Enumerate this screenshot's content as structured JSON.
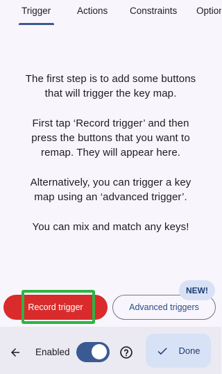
{
  "tabs": [
    {
      "label": "Trigger",
      "selected": true
    },
    {
      "label": "Actions",
      "selected": false
    },
    {
      "label": "Constraints",
      "selected": false
    },
    {
      "label": "Options",
      "selected": false
    }
  ],
  "instructions": {
    "p1": "The first step is to add some buttons\nthat will trigger the key map.",
    "p2": "First tap ‘Record trigger’ and then\npress the buttons that you want to\nremap. They will appear here.",
    "p3": "Alternatively, you can trigger a key\nmap using an ‘advanced trigger’.",
    "p4": "You can mix and match any keys!"
  },
  "buttons": {
    "record_trigger": "Record trigger",
    "advanced_triggers": "Advanced triggers",
    "new_badge": "NEW!"
  },
  "bottom_bar": {
    "enabled_label": "Enabled",
    "enabled_on": true,
    "done_label": "Done"
  },
  "colors": {
    "accent": "#3b5998",
    "record": "#d92b2b",
    "highlight": "#2fb344",
    "tonal": "#d8e2f7"
  }
}
